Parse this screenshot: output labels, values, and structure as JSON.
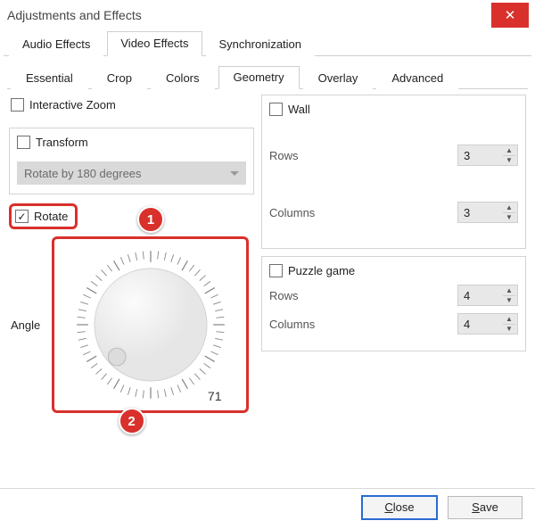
{
  "window": {
    "title": "Adjustments and Effects"
  },
  "tabs": {
    "items": [
      "Audio Effects",
      "Video Effects",
      "Synchronization"
    ],
    "active": 1
  },
  "subtabs": {
    "items": [
      "Essential",
      "Crop",
      "Colors",
      "Geometry",
      "Overlay",
      "Advanced"
    ],
    "active": 3
  },
  "geometry": {
    "interactive_zoom": {
      "label": "Interactive Zoom",
      "checked": false
    },
    "transform": {
      "label": "Transform",
      "checked": false,
      "selected": "Rotate by 180 degrees"
    },
    "rotate": {
      "label": "Rotate",
      "checked": true,
      "angle_label": "Angle",
      "angle": 71
    },
    "wall": {
      "label": "Wall",
      "checked": false,
      "rows_label": "Rows",
      "rows": 3,
      "cols_label": "Columns",
      "cols": 3
    },
    "puzzle": {
      "label": "Puzzle game",
      "checked": false,
      "rows_label": "Rows",
      "rows": 4,
      "cols_label": "Columns",
      "cols": 4
    }
  },
  "annotations": {
    "badge1": "1",
    "badge2": "2"
  },
  "footer": {
    "close": "Close",
    "save": "Save"
  }
}
